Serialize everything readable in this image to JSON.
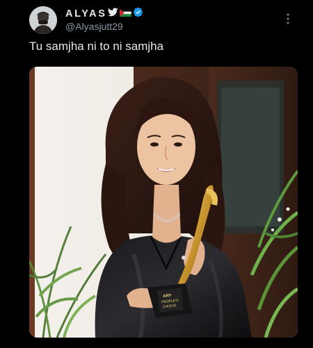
{
  "author": {
    "display_name": "ALYAS",
    "handle": "@Alyasjutt29",
    "badges": [
      "bird-icon",
      "flag-icon",
      "verified-icon"
    ]
  },
  "tweet": {
    "text": "Tu samjha ni to ni samjha"
  },
  "media": {
    "trophy_label_line1": "ARY",
    "trophy_label_line2": "PEOPLE'S",
    "trophy_label_line3": "CHOICE"
  },
  "colors": {
    "background": "#000000",
    "text_primary": "#e7e9ea",
    "text_secondary": "#8b98a5",
    "verified": "#1d9bf0"
  }
}
